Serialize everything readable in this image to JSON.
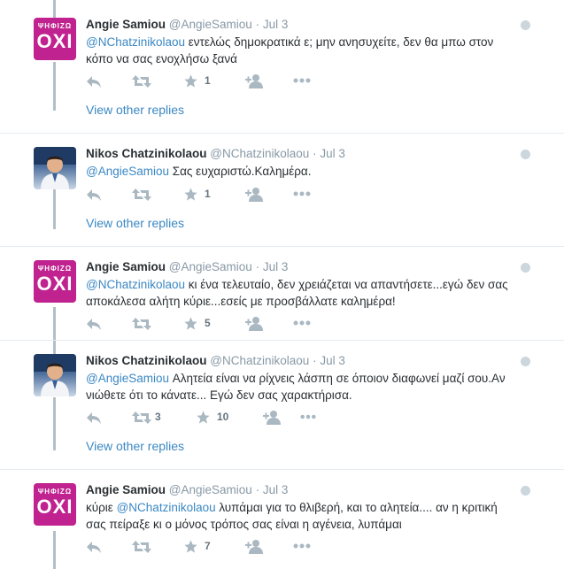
{
  "tweets": [
    {
      "name": "Angie Samiou",
      "handle": "@AngieSamiou",
      "time": "Jul 3",
      "avatar": "oxi",
      "mention": "@NChatzinikolaou",
      "line1_rest": " εντελώς δημοκρατικά ε; μην ανησυχείτε, δεν θα μπω στον",
      "line2": "κόπο να σας ενοχλήσω ξανά",
      "retweets": "",
      "likes": "1",
      "view_replies": "View other replies"
    },
    {
      "name": "Nikos Chatzinikolaou",
      "handle": "@NChatzinikolaou",
      "time": "Jul 3",
      "avatar": "nikos",
      "mention": "@AngieSamiou",
      "line1_rest": " Σας ευχαριστώ.Καλημέρα.",
      "line2": "",
      "retweets": "",
      "likes": "1",
      "view_replies": "View other replies"
    },
    {
      "name": "Angie Samiou",
      "handle": "@AngieSamiou",
      "time": "Jul 3",
      "avatar": "oxi",
      "mention": "@NChatzinikolaou",
      "line1_rest": " κι ένα τελευταίο, δεν χρειάζεται να απαντήσετε...εγώ δεν σας",
      "line2": "αποκάλεσα αλήτη κύριε...εσείς με προσβάλλατε  καλημέρα!",
      "retweets": "",
      "likes": "5",
      "view_replies": ""
    },
    {
      "name": "Nikos Chatzinikolaou",
      "handle": "@NChatzinikolaou",
      "time": "Jul 3",
      "avatar": "nikos",
      "mention": "@AngieSamiou",
      "line1_rest": " Αλητεία είναι να ρίχνεις λάσπη σε όποιον διαφωνεί μαζί σου.Αν",
      "line2": "νιώθετε ότι το κάνατε... Εγώ δεν σας χαρακτήρισα.",
      "retweets": "3",
      "likes": "10",
      "view_replies": "View other replies"
    },
    {
      "name": "Angie Samiou",
      "handle": "@AngieSamiou",
      "time": "Jul 3",
      "avatar": "oxi",
      "mention": "@NChatzinikolaou",
      "line1_prefix": "κύριε ",
      "line1_rest": " λυπάμαι για το θλιβερή, και το αλητεία.... αν η κριτική",
      "line2": "σας πείραξε κι ο μόνος τρόπος σας είναι η αγένεια, λυπάμαι",
      "retweets": "",
      "likes": "7",
      "view_replies": ""
    }
  ],
  "oxi_avatar": {
    "small": "ΨΗΦΙΖΩ",
    "big": "ΟΧΙ"
  },
  "icons": {
    "reply": "reply-icon",
    "retweet": "retweet-icon",
    "like": "star-icon",
    "follow": "add-user-icon",
    "more": "more-icon",
    "privacy": "globe-icon"
  },
  "colors": {
    "link": "#3b88c3",
    "name": "#292f33",
    "muted": "#8899a6",
    "icon": "#aab8c2",
    "oxi": "#c0228f"
  }
}
